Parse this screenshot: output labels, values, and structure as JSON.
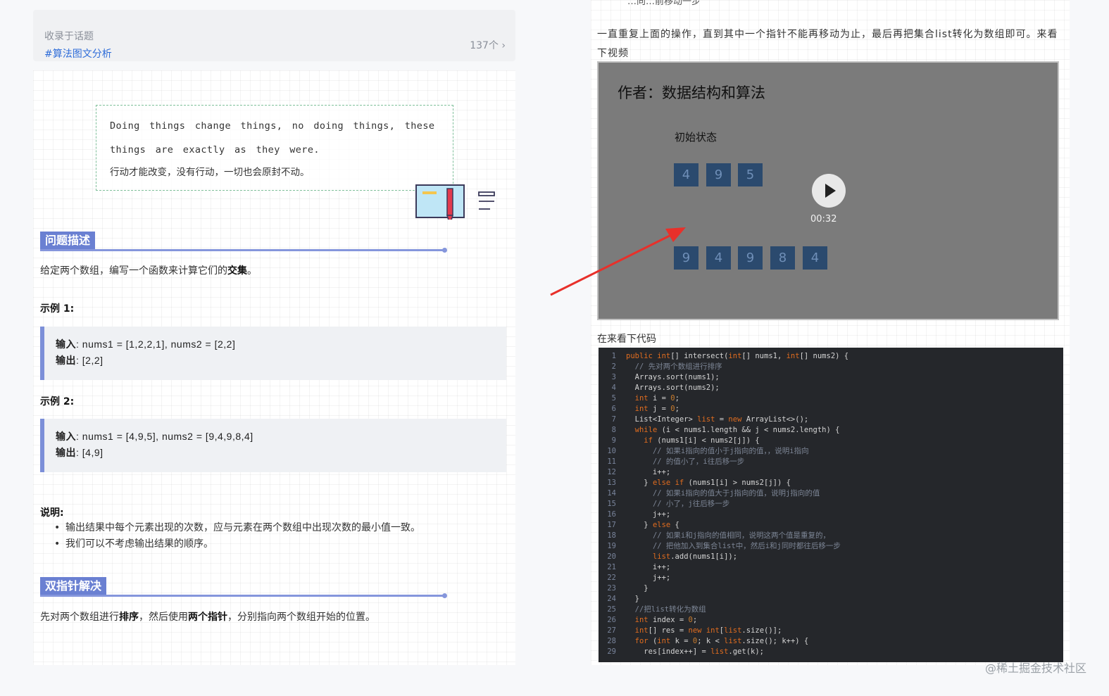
{
  "topic": {
    "label": "收录于话题",
    "tag": "#算法图文分析",
    "count": "137个 ›"
  },
  "quote": {
    "en": "Doing things change things, no doing things, these things are exactly as they were.",
    "zh": "行动才能改变，没有行动，一切也会原封不动。"
  },
  "section1": {
    "title": "问题描述",
    "desc_prefix": "给定两个数组，编写一个函数来计算它们的",
    "desc_bold": "交集",
    "desc_suffix": "。"
  },
  "example1": {
    "title": "示例 1:",
    "input_label": "输入",
    "input_value": ": nums1 = [1,2,2,1], nums2 = [2,2]",
    "output_label": "输出",
    "output_value": ": [2,2]"
  },
  "example2": {
    "title": "示例 2:",
    "input_label": "输入",
    "input_value": ": nums1 = [4,9,5], nums2 = [9,4,9,8,4]",
    "output_label": "输出",
    "output_value": ": [4,9]"
  },
  "notes": {
    "title": "说明:",
    "items": [
      "输出结果中每个元素出现的次数，应与元素在两个数组中出现次数的最小值一致。",
      "我们可以不考虑输出结果的顺序。"
    ]
  },
  "section2": {
    "title": "双指针解决",
    "p1": "先对两个数组进行",
    "b1": "排序",
    "p2": "，然后使用",
    "b2": "两个指针",
    "p3": "，分别指向两个数组开始的位置。"
  },
  "right": {
    "top_snip": "…向…前移动一步",
    "repeat_text": "一直重复上面的操作，直到其中一个指针不能再移动为止，最后再把集合list转化为数组即可。来看下视频",
    "code_intro": "在来看下代码"
  },
  "video": {
    "author": "作者：数据结构和算法",
    "state_label": "初始状态",
    "array1": [
      "4",
      "9",
      "5"
    ],
    "array2": [
      "9",
      "4",
      "9",
      "8",
      "4"
    ],
    "time": "00:32"
  },
  "code_lines": [
    "public int[] intersect(int[] nums1, int[] nums2) {",
    "  // 先对两个数组进行排序",
    "  Arrays.sort(nums1);",
    "  Arrays.sort(nums2);",
    "  int i = 0;",
    "  int j = 0;",
    "  List<Integer> list = new ArrayList<>();",
    "  while (i < nums1.length && j < nums2.length) {",
    "    if (nums1[i] < nums2[j]) {",
    "      // 如果i指向的值小于j指向的值，，说明i指向",
    "      // 的值小了，i往后移一步",
    "      i++;",
    "    } else if (nums1[i] > nums2[j]) {",
    "      // 如果i指向的值大于j指向的值，说明j指向的值",
    "      // 小了，j往后移一步",
    "      j++;",
    "    } else {",
    "      // 如果i和j指向的值相同，说明这两个值是重复的，",
    "      // 把他加入到集合list中，然后i和j同时都往后移一步",
    "      list.add(nums1[i]);",
    "      i++;",
    "      j++;",
    "    }",
    "  }",
    "  //把list转化为数组",
    "  int index = 0;",
    "  int[] res = new int[list.size()];",
    "  for (int k = 0; k < list.size(); k++) {",
    "    res[index++] = list.get(k);"
  ],
  "watermark": "@稀土掘金技术社区",
  "colors": {
    "accent": "#6a80d2",
    "link": "#2f6dd9",
    "arrow": "#e8302a",
    "code_bg": "#25272b"
  }
}
